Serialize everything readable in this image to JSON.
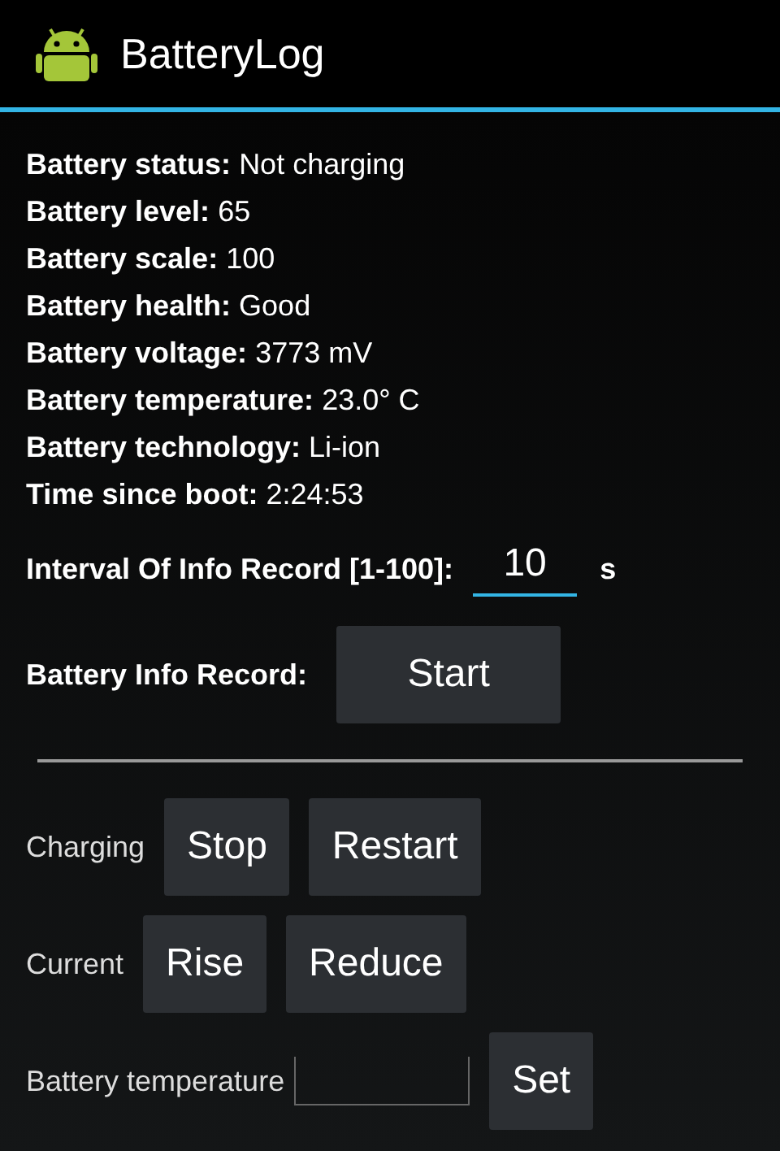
{
  "app_bar": {
    "title": "BatteryLog"
  },
  "info": [
    {
      "label": "Battery status:",
      "value": "Not charging"
    },
    {
      "label": "Battery level:",
      "value": "65"
    },
    {
      "label": "Battery scale:",
      "value": "100"
    },
    {
      "label": "Battery health:",
      "value": "Good"
    },
    {
      "label": "Battery voltage:",
      "value": "3773 mV"
    },
    {
      "label": "Battery temperature:",
      "value": "23.0° C"
    },
    {
      "label": "Battery technology:",
      "value": "Li-ion"
    },
    {
      "label": "Time since boot:",
      "value": "2:24:53"
    }
  ],
  "interval": {
    "label": "Interval Of Info Record [1-100]:",
    "value": "10",
    "unit": "s"
  },
  "record": {
    "label": "Battery Info Record:",
    "button": "Start"
  },
  "controls": [
    {
      "kind": "buttons",
      "label": "Charging",
      "buttons": [
        "Stop",
        "Restart"
      ]
    },
    {
      "kind": "buttons",
      "label": "Current",
      "buttons": [
        "Rise",
        "Reduce"
      ]
    },
    {
      "kind": "input",
      "label": "Battery temperature",
      "buttons": [
        "Set"
      ]
    }
  ]
}
